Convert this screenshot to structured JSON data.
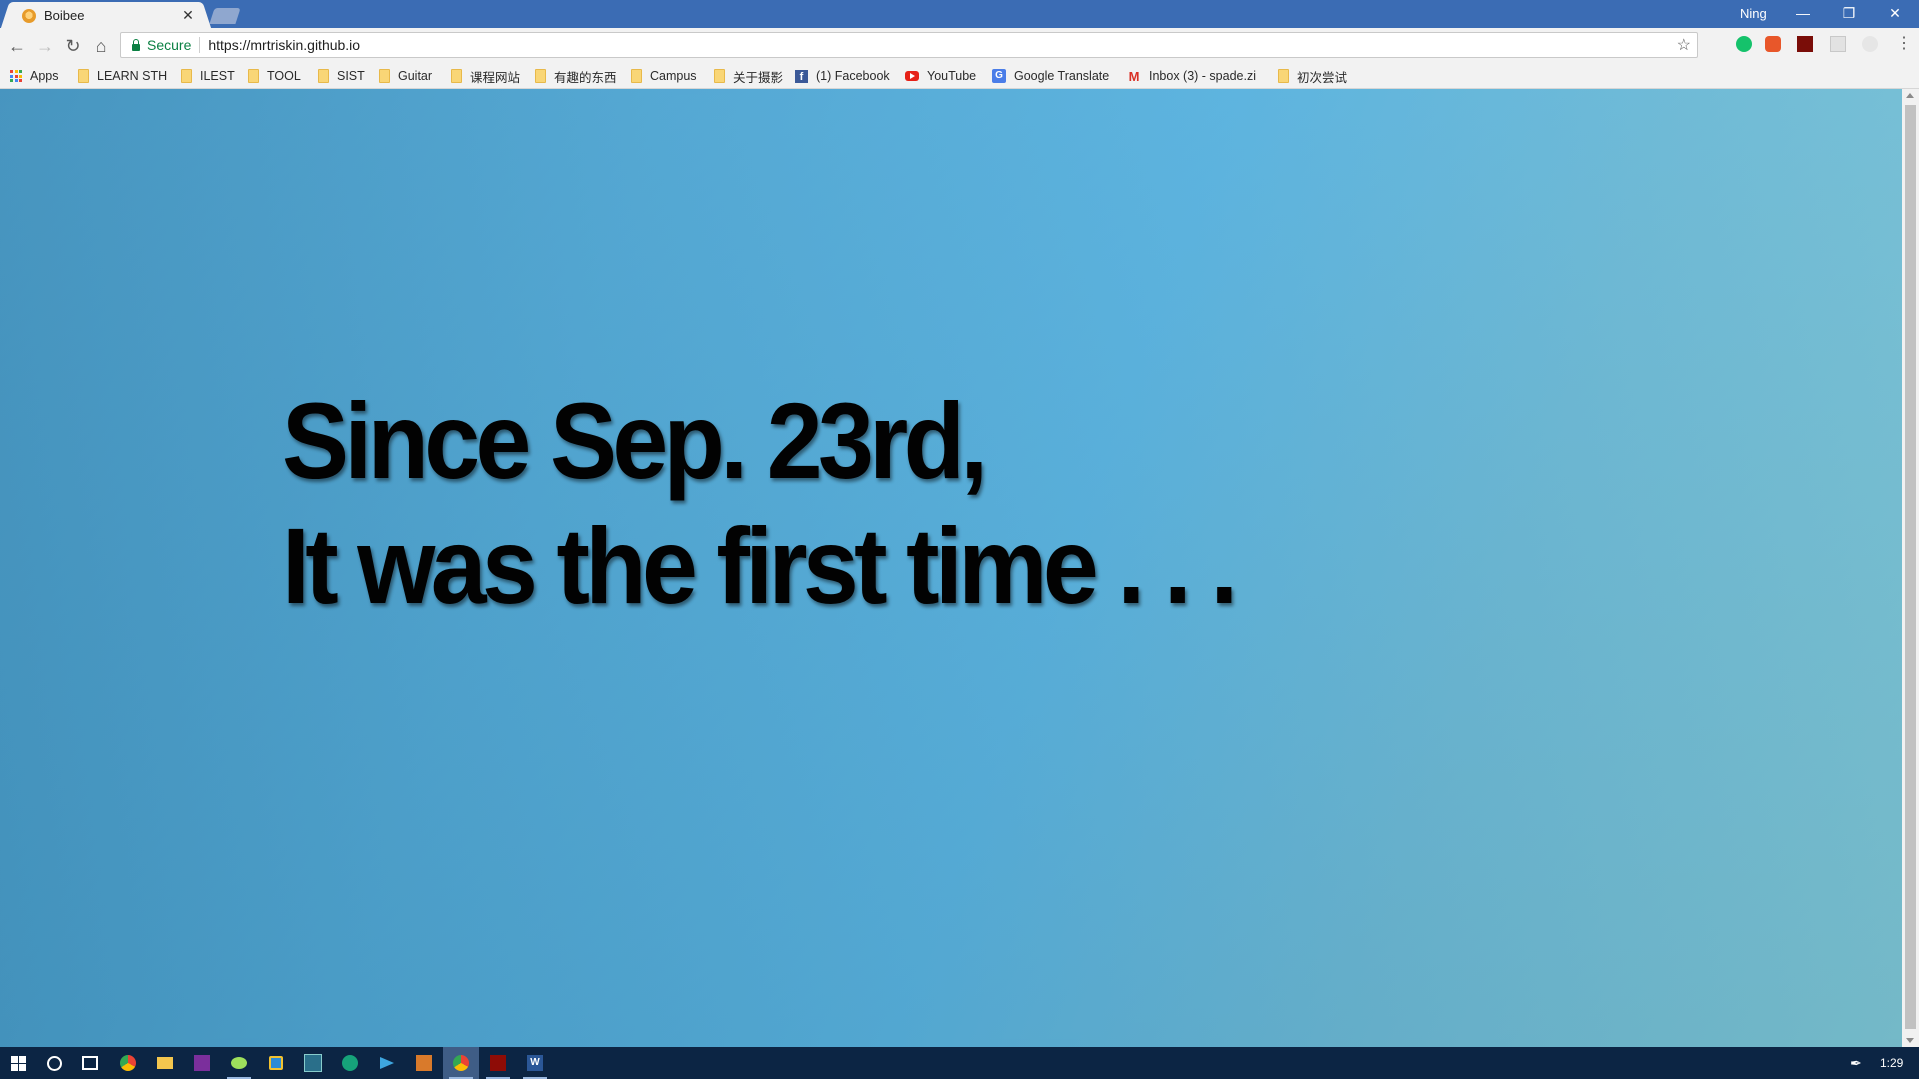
{
  "tab": {
    "title": "Boibee",
    "close_glyph": "✕",
    "favicon": "bee-favicon-icon"
  },
  "window": {
    "profile": "Ning",
    "minimize": "—",
    "maximize": "❐",
    "close": "✕"
  },
  "toolbar": {
    "back": "←",
    "forward": "→",
    "reload": "↻",
    "home": "⌂",
    "secure_label": "Secure",
    "url": "https://mrtriskin.github.io",
    "star": "☆",
    "menu": "⋮",
    "extensions": [
      "grammarly-icon",
      "fire-icon",
      "pdf-icon",
      "page-icon",
      "circle-icon"
    ]
  },
  "bookmarks": [
    {
      "label": "Apps",
      "icon": "apps-grid-icon"
    },
    {
      "label": "LEARN STH",
      "icon": "folder-icon"
    },
    {
      "label": "ILEST",
      "icon": "folder-icon"
    },
    {
      "label": "TOOL",
      "icon": "folder-icon"
    },
    {
      "label": "SIST",
      "icon": "folder-icon"
    },
    {
      "label": "Guitar",
      "icon": "folder-icon"
    },
    {
      "label": "课程网站",
      "icon": "folder-icon"
    },
    {
      "label": "有趣的东西",
      "icon": "folder-icon"
    },
    {
      "label": "Campus",
      "icon": "folder-icon"
    },
    {
      "label": "关于摄影",
      "icon": "folder-icon"
    },
    {
      "label": "(1) Facebook",
      "icon": "facebook-icon"
    },
    {
      "label": "YouTube",
      "icon": "youtube-icon"
    },
    {
      "label": "Google Translate",
      "icon": "google-translate-icon"
    },
    {
      "label": "Inbox (3) - spade.zi",
      "icon": "gmail-icon"
    },
    {
      "label": "初次尝试",
      "icon": "folder-icon"
    }
  ],
  "page": {
    "line1": "Since Sep. 23rd,",
    "line2": "It was the first time . . ."
  },
  "taskbar": {
    "clock": "1:29",
    "apps": [
      "windows-start-icon",
      "search-circle-icon",
      "task-view-icon",
      "chrome-icon",
      "file-explorer-icon",
      "onenote-icon",
      "wechat-icon",
      "app-square-icon",
      "app-screen-icon",
      "app-green-icon",
      "telegram-icon",
      "app-box-icon",
      "chrome-active-icon",
      "acrobat-icon",
      "word-icon"
    ],
    "tray_pen": "✒"
  },
  "colors": {
    "titlebar": "#3b6cb4",
    "page_gradient_left": "#4091bd",
    "page_gradient_right": "#7bc4d4",
    "headline": "#020202",
    "taskbar": "#0c2544"
  }
}
